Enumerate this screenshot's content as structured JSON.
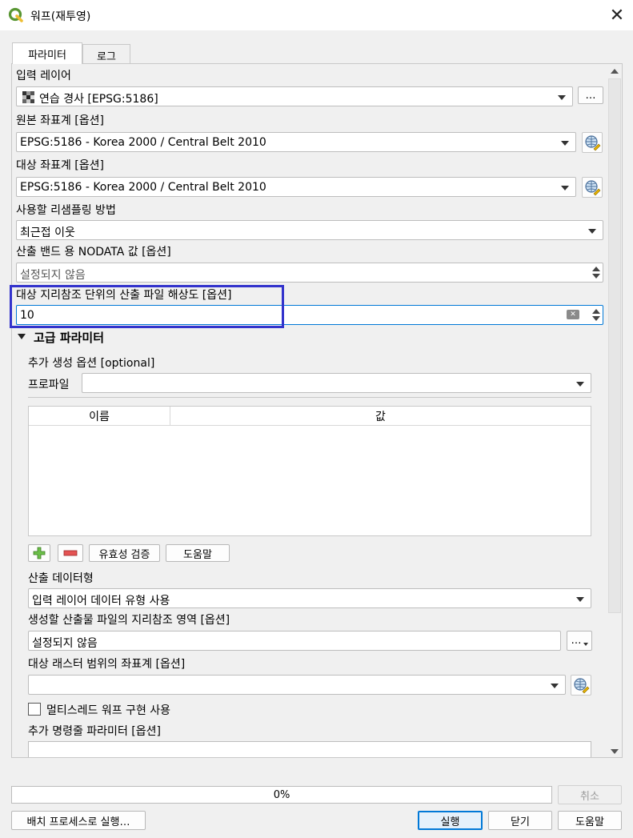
{
  "window": {
    "title": "워프(재투영)"
  },
  "tabs": [
    {
      "label": "파라미터"
    },
    {
      "label": "로그"
    }
  ],
  "params": {
    "input_layer": {
      "label": "입력 레이어",
      "value": "연습 경사 [EPSG:5186]",
      "browse": "…"
    },
    "source_crs": {
      "label": "원본 좌표계 [옵션]",
      "value": "EPSG:5186 - Korea 2000 / Central Belt 2010"
    },
    "target_crs": {
      "label": "대상 좌표계 [옵션]",
      "value": "EPSG:5186 - Korea 2000 / Central Belt 2010"
    },
    "resampling": {
      "label": "사용할 리샘플링 방법",
      "value": "최근접 이웃"
    },
    "nodata": {
      "label": "산출 밴드 용 NODATA 값 [옵션]",
      "value": "설정되지 않음"
    },
    "resolution": {
      "label": "대상 지리참조 단위의 산출 파일 해상도 [옵션]",
      "value": "10"
    }
  },
  "advanced": {
    "header": "고급 파라미터",
    "creation_options": {
      "label": "추가 생성 옵션 [optional]",
      "profile_label": "프로파일",
      "profile_value": ""
    },
    "table": {
      "columns": [
        "이름",
        "값"
      ]
    },
    "buttons": {
      "validate": "유효성 검증",
      "help": "도움말"
    },
    "output_type": {
      "label": "산출 데이터형",
      "value": "입력 레이어 데이터 유형 사용"
    },
    "extent": {
      "label": "생성할 산출물 파일의 지리참조 영역 [옵션]",
      "value": "설정되지 않음",
      "browse": "…"
    },
    "extent_crs": {
      "label": "대상 래스터 범위의 좌표계 [옵션]",
      "value": ""
    },
    "multithread": {
      "label": "멀티스레드 워프 구현 사용",
      "checked": false
    },
    "extra_cmd": {
      "label": "추가 명령줄 파라미터 [옵션]",
      "value": ""
    }
  },
  "footer": {
    "progress": {
      "text": "0%",
      "value": 0
    },
    "cancel": "취소",
    "batch": "배치 프로세스로 실행…",
    "run": "실행",
    "close": "닫기",
    "help": "도움말"
  },
  "colors": {
    "highlight": "#3333cc",
    "accent": "#0078d7"
  }
}
